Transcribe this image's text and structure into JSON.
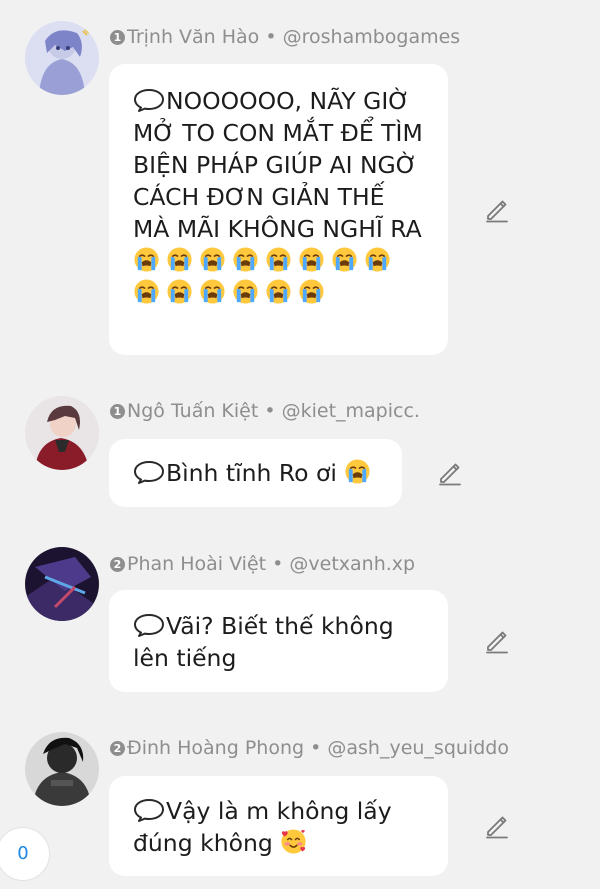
{
  "comments": [
    {
      "rank": "1",
      "name": "Trịnh Văn Hào",
      "separator": " • ",
      "handle": "@roshambogames",
      "text": "NOOOOOO, NÃY GIỜ MỞ TO CON MẮT ĐỂ TÌM BIỆN PHÁP GIÚP AI NGỜ CÁCH ĐƠN GIẢN THẾ MÀ MÃI KHÔNG NGHĨ RA",
      "emoji_count": 14,
      "emoji": "loudly-crying-face"
    },
    {
      "rank": "1",
      "name": "Ngô Tuấn Kiệt",
      "separator": " • ",
      "handle": "@kiet_mapicc.",
      "text": "Bình tĩnh Ro ơi",
      "emoji_count": 1,
      "emoji": "loudly-crying-face"
    },
    {
      "rank": "2",
      "name": "Phan Hoài Việt",
      "separator": " • ",
      "handle": "@vetxanh.xp",
      "text": "Vãi? Biết thế không lên tiếng",
      "emoji_count": 0
    },
    {
      "rank": "2",
      "name": "Đinh Hoàng Phong",
      "separator": " • ",
      "handle": "@ash_yeu_squiddo",
      "text": "Vậy là m không lấy đúng không",
      "emoji_count": 1,
      "emoji": "smiling-face-with-hearts"
    }
  ],
  "counter": "0",
  "colors": {
    "background": "#f1f1f1",
    "bubble": "#ffffff",
    "meta_text": "#8e8e8e",
    "counter_text": "#1e88e5"
  }
}
